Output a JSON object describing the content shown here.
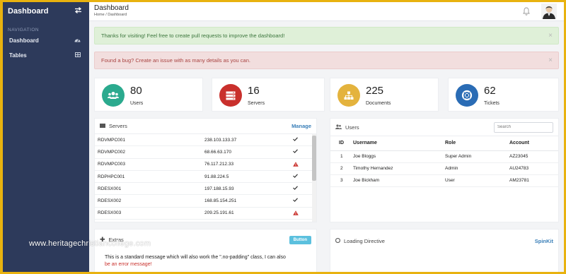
{
  "brand": {
    "title": "Dashboard"
  },
  "nav": {
    "header": "NAVIGATION",
    "items": [
      {
        "label": "Dashboard",
        "icon": "tachometer-icon"
      },
      {
        "label": "Tables",
        "icon": "table-icon"
      }
    ]
  },
  "header": {
    "title": "Dashboard",
    "breadcrumb": "Home / Dashboard"
  },
  "alerts": {
    "success": "Thanks for visiting! Feel free to create pull requests to improve the dashboard!",
    "danger": "Found a bug? Create an issue with as many details as you can.",
    "close": "×"
  },
  "widgets": [
    {
      "value": "80",
      "label": "Users",
      "color": "#2baa8e",
      "icon": "users-icon"
    },
    {
      "value": "16",
      "label": "Servers",
      "color": "#c9302c",
      "icon": "server-icon"
    },
    {
      "value": "225",
      "label": "Documents",
      "color": "#e4b33d",
      "icon": "sitemap-icon"
    },
    {
      "value": "62",
      "label": "Tickets",
      "color": "#2a6cb5",
      "icon": "life-ring-icon"
    }
  ],
  "servers": {
    "title": "Servers",
    "manage": "Manage",
    "rows": [
      {
        "name": "RDVMPC001",
        "ip": "238.103.133.37",
        "status": "ok"
      },
      {
        "name": "RDVMPC002",
        "ip": "68.66.63.170",
        "status": "ok"
      },
      {
        "name": "RDVMPC003",
        "ip": "76.117.212.33",
        "status": "warning"
      },
      {
        "name": "RDPHPC001",
        "ip": "91.88.224.5",
        "status": "ok"
      },
      {
        "name": "RDESX001",
        "ip": "197.188.15.93",
        "status": "ok"
      },
      {
        "name": "RDESX002",
        "ip": "168.85.154.251",
        "status": "ok"
      },
      {
        "name": "RDESX003",
        "ip": "209.25.191.61",
        "status": "warning"
      }
    ]
  },
  "users": {
    "title": "Users",
    "search_placeholder": "Search",
    "columns": [
      "ID",
      "Username",
      "Role",
      "Account"
    ],
    "rows": [
      [
        "1",
        "Joe Bloggs",
        "Super Admin",
        "AZ23045"
      ],
      [
        "2",
        "Timothy Hernandez",
        "Admin",
        "AU24783"
      ],
      [
        "3",
        "Joe Bickham",
        "User",
        "AM23781"
      ]
    ]
  },
  "extras": {
    "title": "Extras",
    "button": "Button",
    "message": "This is a standard message which will also work the \".no-padding\" class, I can also",
    "error": "be an error message!"
  },
  "loading": {
    "title": "Loading Directive",
    "link": "SpinKit"
  },
  "watermark": "www.heritagechristiancollege.com"
}
